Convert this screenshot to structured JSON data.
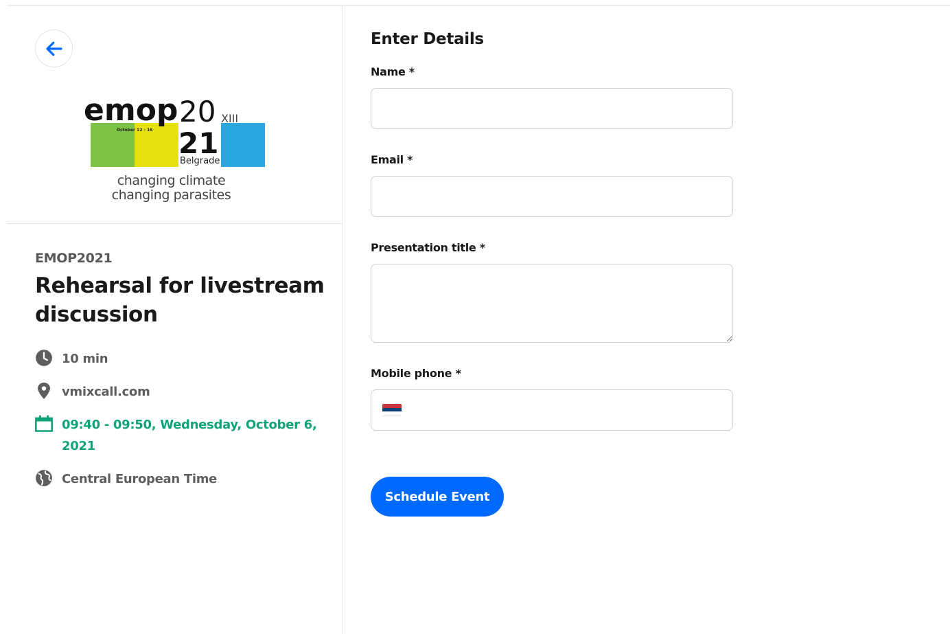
{
  "colors": {
    "accent": "#0069ff",
    "date": "#10a37a",
    "muted": "#5e5e5e"
  },
  "sidebar": {
    "back_icon": "arrow-left-icon",
    "logo": {
      "wordmark": "emop",
      "year_top": "20",
      "year_bottom": "21",
      "edition": "XIII",
      "dates": "October 12 - 16",
      "city": "Belgrade",
      "caption_line1": "changing climate",
      "caption_line2": "changing parasites"
    },
    "organizer": "EMOP2021",
    "event_title": "Rehearsal for livestream discussion",
    "details": {
      "duration": "10 min",
      "location": "vmixcall.com",
      "datetime": "09:40 - 09:50, Wednesday, October 6, 2021",
      "timezone": "Central European Time"
    }
  },
  "form": {
    "title": "Enter Details",
    "name_label": "Name *",
    "email_label": "Email *",
    "presentation_label": "Presentation title *",
    "phone_label": "Mobile phone *",
    "phone_country": "RS",
    "submit_label": "Schedule Event"
  }
}
